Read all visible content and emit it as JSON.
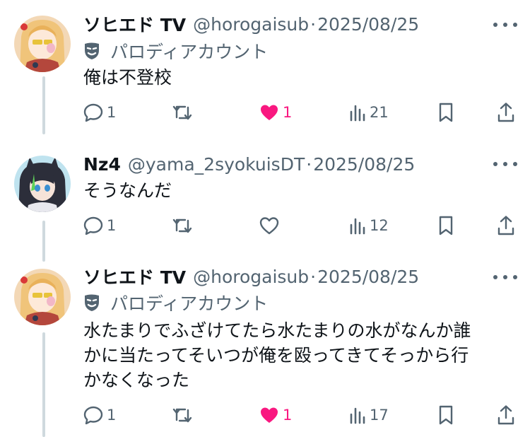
{
  "tweets": [
    {
      "display_name": "ソヒエド TV",
      "handle": "@horogaisub",
      "separator": "·",
      "date": "2025/08/25",
      "label": "パロディアカウント",
      "text_lines": [
        "俺は不登校"
      ],
      "replies": "1",
      "retweets": "",
      "likes": "1",
      "liked": true,
      "views": "21"
    },
    {
      "display_name": "Nz4",
      "handle": "@yama_2syokuisDT",
      "separator": "·",
      "date": "2025/08/25",
      "text_lines": [
        "そうなんだ"
      ],
      "replies": "1",
      "retweets": "",
      "likes": "",
      "liked": false,
      "views": "12"
    },
    {
      "display_name": "ソヒエド TV",
      "handle": "@horogaisub",
      "separator": "·",
      "date": "2025/08/25",
      "label": "パロディアカウント",
      "text_lines": [
        "水たまりでふざけてたら水たまりの水がなんか誰",
        "かに当たってそいつが俺を殴ってきてそっから行",
        "かなくなった"
      ],
      "replies": "1",
      "retweets": "",
      "likes": "1",
      "liked": true,
      "views": "17"
    }
  ],
  "colors": {
    "text": "#0f1419",
    "secondary": "#536471",
    "like": "#f91880",
    "thread_line": "#cfd9de"
  },
  "icons": [
    "mask-icon",
    "reply-icon",
    "retweet-icon",
    "heart-icon",
    "views-icon",
    "bookmark-icon",
    "share-icon",
    "more-icon"
  ]
}
